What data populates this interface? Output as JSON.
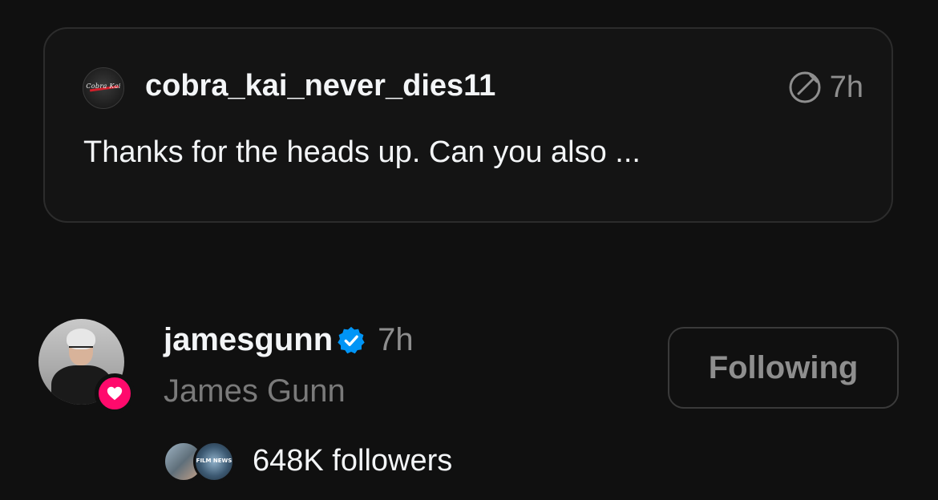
{
  "reply": {
    "avatar_logo_text": "Cobra Kai",
    "username": "cobra_kai_never_dies11",
    "time": "7h",
    "text": "Thanks for the heads up. Can you also ..."
  },
  "profile": {
    "username": "jamesgunn",
    "verified": true,
    "time": "7h",
    "full_name": "James Gunn",
    "follow_button_label": "Following",
    "followers_text": "648K followers",
    "follower_avatar_2_text": "FILM NEWS"
  },
  "colors": {
    "background": "#101010",
    "verified_blue": "#0095f6",
    "heart_badge": "#ff0a6c",
    "secondary_text": "#8e8e8e"
  },
  "icons": {
    "reply_status": "compose-icon",
    "verified": "verified-badge-icon",
    "badge": "heart-icon"
  }
}
